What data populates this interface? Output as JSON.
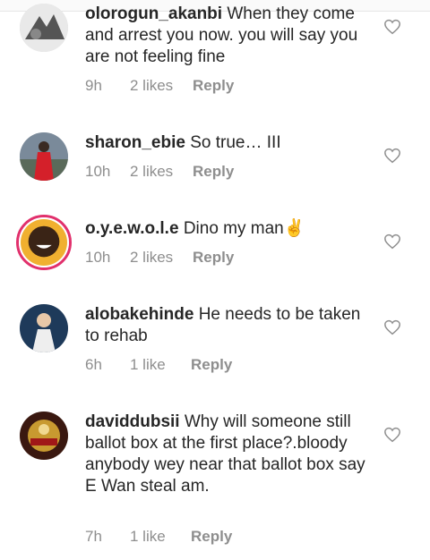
{
  "comments": [
    {
      "username": "olorogun_akanbi",
      "text": "When they come and arrest you now. you will say you are not feeling fine",
      "time": "9h",
      "likes": "2 likes",
      "reply": "Reply",
      "avatar_icon": "avatar-photo-icon"
    },
    {
      "username": "sharon_ebie",
      "text": "So true… III",
      "time": "10h",
      "likes": "2 likes",
      "reply": "Reply",
      "avatar_icon": "avatar-photo-icon"
    },
    {
      "username": "o.y.e.w.o.l.e",
      "text": "Dino my man✌",
      "time": "10h",
      "likes": "2 likes",
      "reply": "Reply",
      "avatar_icon": "avatar-photo-icon"
    },
    {
      "username": "alobakehinde",
      "text": "He needs to be taken to rehab",
      "time": "6h",
      "likes": "1 like",
      "reply": "Reply",
      "avatar_icon": "avatar-photo-icon"
    },
    {
      "username": "daviddubsii",
      "text": "Why will someone still ballot box at the first place?.bloody anybody wey near that ballot box say E Wan steal am.",
      "time": "7h",
      "likes": "1 like",
      "reply": "Reply",
      "avatar_icon": "avatar-photo-icon"
    }
  ],
  "icons": {
    "like": "heart-outline-icon"
  },
  "colors": {
    "meta": "#8e8e8e",
    "text": "#262626",
    "story_ring": "#e1306c"
  }
}
